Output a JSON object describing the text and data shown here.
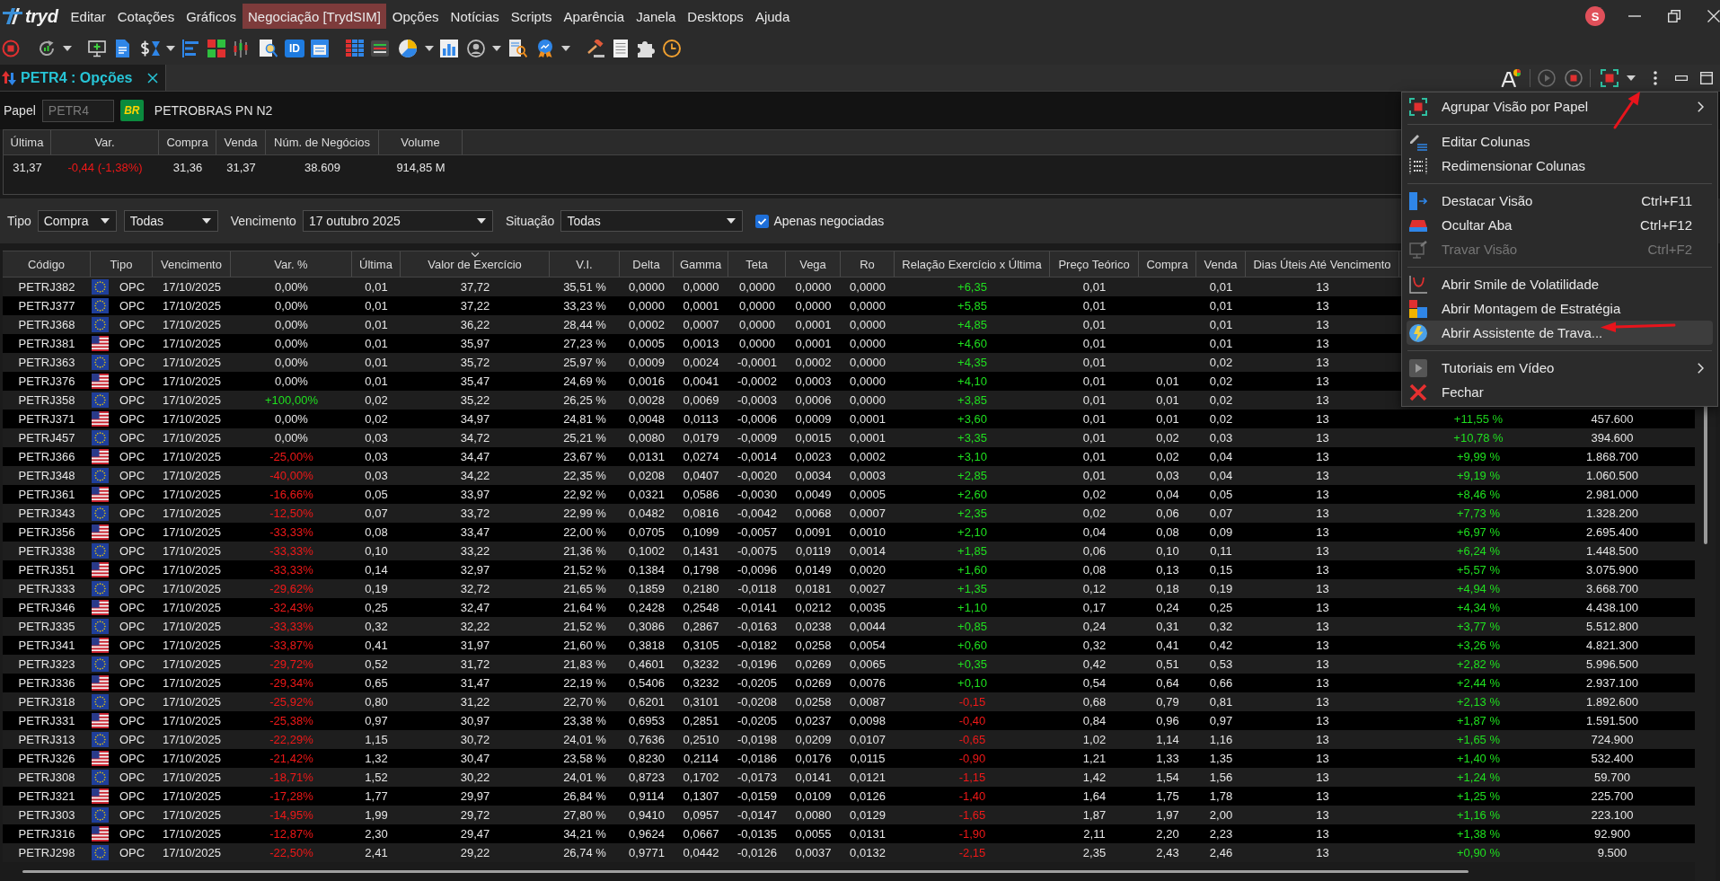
{
  "window": {
    "logo_text": "tryd",
    "avatar_letter": "S"
  },
  "menu_bar": [
    {
      "label": "Editar",
      "selected": false
    },
    {
      "label": "Cotações",
      "selected": false
    },
    {
      "label": "Gráficos",
      "selected": false
    },
    {
      "label": "Negociação [TrydSIM]",
      "selected": true
    },
    {
      "label": "Opções",
      "selected": false
    },
    {
      "label": "Notícias",
      "selected": false
    },
    {
      "label": "Scripts",
      "selected": false
    },
    {
      "label": "Aparência",
      "selected": false
    },
    {
      "label": "Janela",
      "selected": false
    },
    {
      "label": "Desktops",
      "selected": false
    },
    {
      "label": "Ajuda",
      "selected": false
    }
  ],
  "toolbar": {
    "text_button": "ID"
  },
  "tabs": [
    {
      "label": "PETR4 : Opções",
      "selected": true
    }
  ],
  "instrument": {
    "label": "Papel",
    "placeholder": "PETR4",
    "logo_text": "BR",
    "name": "PETROBRAS PN N2"
  },
  "quote": {
    "columns": [
      "Última",
      "Var.",
      "Compra",
      "Venda",
      "Núm. de Negócios",
      "Volume"
    ],
    "values": [
      {
        "text": "31,37",
        "color": "#e6e6e6"
      },
      {
        "text": "-0,44 (-1,38%)",
        "color": "#f01818"
      },
      {
        "text": "31,36",
        "color": "#e6e6e6"
      },
      {
        "text": "31,37",
        "color": "#e6e6e6"
      },
      {
        "text": "38.609",
        "color": "#e6e6e6"
      },
      {
        "text": "914,85 M",
        "color": "#e6e6e6"
      }
    ]
  },
  "filters": [
    {
      "kind": "label",
      "text": "Tipo"
    },
    {
      "kind": "dropdown",
      "value": "Compra"
    },
    {
      "kind": "dropdown",
      "value": "Todas"
    },
    {
      "kind": "label",
      "text": "Vencimento"
    },
    {
      "kind": "dropdown",
      "value": "17 outubro 2025"
    },
    {
      "kind": "label",
      "text": "Situação"
    },
    {
      "kind": "dropdown",
      "value": "Todas"
    },
    {
      "kind": "checkbox",
      "label": "Apenas negociadas",
      "checked": true
    }
  ],
  "table": {
    "columns": [
      {
        "label": "Código",
        "sorted": false
      },
      {
        "label": "Tipo",
        "sorted": false
      },
      {
        "label": "Vencimento",
        "sorted": false
      },
      {
        "label": "Var. %",
        "sorted": false
      },
      {
        "label": "Última",
        "sorted": false
      },
      {
        "label": "Valor de Exercício",
        "sorted": true
      },
      {
        "label": "V.I.",
        "sorted": false
      },
      {
        "label": "Delta",
        "sorted": false
      },
      {
        "label": "Gamma",
        "sorted": false
      },
      {
        "label": "Teta",
        "sorted": false
      },
      {
        "label": "Vega",
        "sorted": false
      },
      {
        "label": "Ro",
        "sorted": false
      },
      {
        "label": "Relação Exercício x Última",
        "sorted": false
      },
      {
        "label": "Preço Teórico",
        "sorted": false
      },
      {
        "label": "Compra",
        "sorted": false
      },
      {
        "label": "Venda",
        "sorted": false
      },
      {
        "label": "Dias Úteis Até Vencimento",
        "sorted": false
      }
    ],
    "rows": [
      {
        "codigo": "PETRJ382",
        "kind": "eu",
        "tipo": "OPC",
        "vencimento": "17/10/2025",
        "var": {
          "text": "0,00%",
          "color": "#e6e6e6"
        },
        "ultima": "0,01",
        "valor_exercicio": "37,72",
        "vi": "35,51 %",
        "delta": "0,0000",
        "gamma": "0,0000",
        "teta": "0,0000",
        "vega": "0,0000",
        "ro": "0,0000",
        "relacao": {
          "text": "+6,35",
          "color": "#1fe01f"
        },
        "preco_teorico": "0,01",
        "venda": "0,01",
        "dias_uteis": "13"
      },
      {
        "codigo": "PETRJ377",
        "kind": "eu",
        "tipo": "OPC",
        "vencimento": "17/10/2025",
        "var": {
          "text": "0,00%",
          "color": "#e6e6e6"
        },
        "ultima": "0,01",
        "valor_exercicio": "37,22",
        "vi": "33,23 %",
        "delta": "0,0000",
        "gamma": "0,0001",
        "teta": "0,0000",
        "vega": "0,0000",
        "ro": "0,0000",
        "relacao": {
          "text": "+5,85",
          "color": "#1fe01f"
        },
        "preco_teorico": "0,01",
        "venda": "0,01",
        "dias_uteis": "13"
      },
      {
        "codigo": "PETRJ368",
        "kind": "eu",
        "tipo": "OPC",
        "vencimento": "17/10/2025",
        "var": {
          "text": "0,00%",
          "color": "#e6e6e6"
        },
        "ultima": "0,01",
        "valor_exercicio": "36,22",
        "vi": "28,44 %",
        "delta": "0,0002",
        "gamma": "0,0007",
        "teta": "0,0000",
        "vega": "0,0001",
        "ro": "0,0000",
        "relacao": {
          "text": "+4,85",
          "color": "#1fe01f"
        },
        "preco_teorico": "0,01",
        "venda": "0,01",
        "dias_uteis": "13"
      },
      {
        "codigo": "PETRJ381",
        "kind": "us",
        "tipo": "OPC",
        "vencimento": "17/10/2025",
        "var": {
          "text": "0,00%",
          "color": "#e6e6e6"
        },
        "ultima": "0,01",
        "valor_exercicio": "35,97",
        "vi": "27,23 %",
        "delta": "0,0005",
        "gamma": "0,0013",
        "teta": "0,0000",
        "vega": "0,0001",
        "ro": "0,0000",
        "relacao": {
          "text": "+4,60",
          "color": "#1fe01f"
        },
        "preco_teorico": "0,01",
        "venda": "0,01",
        "dias_uteis": "13"
      },
      {
        "codigo": "PETRJ363",
        "kind": "eu",
        "tipo": "OPC",
        "vencimento": "17/10/2025",
        "var": {
          "text": "0,00%",
          "color": "#e6e6e6"
        },
        "ultima": "0,01",
        "valor_exercicio": "35,72",
        "vi": "25,97 %",
        "delta": "0,0009",
        "gamma": "0,0024",
        "teta": "-0,0001",
        "vega": "0,0002",
        "ro": "0,0000",
        "relacao": {
          "text": "+4,35",
          "color": "#1fe01f"
        },
        "preco_teorico": "0,01",
        "venda": "0,02",
        "dias_uteis": "13"
      },
      {
        "codigo": "PETRJ376",
        "kind": "us",
        "tipo": "OPC",
        "vencimento": "17/10/2025",
        "var": {
          "text": "0,00%",
          "color": "#e6e6e6"
        },
        "ultima": "0,01",
        "valor_exercicio": "35,47",
        "vi": "24,69 %",
        "delta": "0,0016",
        "gamma": "0,0041",
        "teta": "-0,0002",
        "vega": "0,0003",
        "ro": "0,0000",
        "relacao": {
          "text": "+4,10",
          "color": "#1fe01f"
        },
        "preco_teorico": "0,01",
        "compra": "0,01",
        "venda": "0,02",
        "dias_uteis": "13"
      },
      {
        "codigo": "PETRJ358",
        "kind": "eu",
        "tipo": "OPC",
        "vencimento": "17/10/2025",
        "var": {
          "text": "+100,00%",
          "color": "#1fe01f"
        },
        "ultima": "0,02",
        "valor_exercicio": "35,22",
        "vi": "26,25 %",
        "delta": "0,0028",
        "gamma": "0,0069",
        "teta": "-0,0003",
        "vega": "0,0006",
        "ro": "0,0000",
        "relacao": {
          "text": "+3,85",
          "color": "#1fe01f"
        },
        "preco_teorico": "0,01",
        "compra": "0,01",
        "venda": "0,02",
        "dias_uteis": "13"
      },
      {
        "codigo": "PETRJ371",
        "kind": "us",
        "tipo": "OPC",
        "vencimento": "17/10/2025",
        "var": {
          "text": "0,00%",
          "color": "#e6e6e6"
        },
        "ultima": "0,02",
        "valor_exercicio": "34,97",
        "vi": "24,81 %",
        "delta": "0,0048",
        "gamma": "0,0113",
        "teta": "-0,0006",
        "vega": "0,0009",
        "ro": "0,0001",
        "relacao": {
          "text": "+3,60",
          "color": "#1fe01f"
        },
        "preco_teorico": "0,01",
        "compra": "0,01",
        "venda": "0,02",
        "dias_uteis": "13",
        "column_18": "+11,55 %",
        "column_19": "457.600"
      },
      {
        "codigo": "PETRJ457",
        "kind": "eu",
        "tipo": "OPC",
        "vencimento": "17/10/2025",
        "var": {
          "text": "0,00%",
          "color": "#e6e6e6"
        },
        "ultima": "0,03",
        "valor_exercicio": "34,72",
        "vi": "25,21 %",
        "delta": "0,0080",
        "gamma": "0,0179",
        "teta": "-0,0009",
        "vega": "0,0015",
        "ro": "0,0001",
        "relacao": {
          "text": "+3,35",
          "color": "#1fe01f"
        },
        "preco_teorico": "0,01",
        "compra": "0,02",
        "venda": "0,03",
        "dias_uteis": "13",
        "column_18": "+10,78 %",
        "column_19": "394.600"
      },
      {
        "codigo": "PETRJ366",
        "kind": "us",
        "tipo": "OPC",
        "vencimento": "17/10/2025",
        "var": {
          "text": "-25,00%",
          "color": "#f01818"
        },
        "ultima": "0,03",
        "valor_exercicio": "34,47",
        "vi": "23,67 %",
        "delta": "0,0131",
        "gamma": "0,0274",
        "teta": "-0,0014",
        "vega": "0,0023",
        "ro": "0,0002",
        "relacao": {
          "text": "+3,10",
          "color": "#1fe01f"
        },
        "preco_teorico": "0,01",
        "compra": "0,02",
        "venda": "0,04",
        "dias_uteis": "13",
        "column_18": "+9,99 %",
        "column_19": "1.868.700"
      },
      {
        "codigo": "PETRJ348",
        "kind": "eu",
        "tipo": "OPC",
        "vencimento": "17/10/2025",
        "var": {
          "text": "-40,00%",
          "color": "#f01818"
        },
        "ultima": "0,03",
        "valor_exercicio": "34,22",
        "vi": "22,35 %",
        "delta": "0,0208",
        "gamma": "0,0407",
        "teta": "-0,0020",
        "vega": "0,0034",
        "ro": "0,0003",
        "relacao": {
          "text": "+2,85",
          "color": "#1fe01f"
        },
        "preco_teorico": "0,01",
        "compra": "0,03",
        "venda": "0,04",
        "dias_uteis": "13",
        "column_18": "+9,19 %",
        "column_19": "1.060.500"
      },
      {
        "codigo": "PETRJ361",
        "kind": "us",
        "tipo": "OPC",
        "vencimento": "17/10/2025",
        "var": {
          "text": "-16,66%",
          "color": "#f01818"
        },
        "ultima": "0,05",
        "valor_exercicio": "33,97",
        "vi": "22,92 %",
        "delta": "0,0321",
        "gamma": "0,0586",
        "teta": "-0,0030",
        "vega": "0,0049",
        "ro": "0,0005",
        "relacao": {
          "text": "+2,60",
          "color": "#1fe01f"
        },
        "preco_teorico": "0,02",
        "compra": "0,04",
        "venda": "0,05",
        "dias_uteis": "13",
        "column_18": "+8,46 %",
        "column_19": "2.981.000"
      },
      {
        "codigo": "PETRJ343",
        "kind": "eu",
        "tipo": "OPC",
        "vencimento": "17/10/2025",
        "var": {
          "text": "-12,50%",
          "color": "#f01818"
        },
        "ultima": "0,07",
        "valor_exercicio": "33,72",
        "vi": "22,99 %",
        "delta": "0,0482",
        "gamma": "0,0816",
        "teta": "-0,0042",
        "vega": "0,0068",
        "ro": "0,0007",
        "relacao": {
          "text": "+2,35",
          "color": "#1fe01f"
        },
        "preco_teorico": "0,02",
        "compra": "0,06",
        "venda": "0,07",
        "dias_uteis": "13",
        "column_18": "+7,73 %",
        "column_19": "1.328.200"
      },
      {
        "codigo": "PETRJ356",
        "kind": "us",
        "tipo": "OPC",
        "vencimento": "17/10/2025",
        "var": {
          "text": "-33,33%",
          "color": "#f01818"
        },
        "ultima": "0,08",
        "valor_exercicio": "33,47",
        "vi": "22,00 %",
        "delta": "0,0705",
        "gamma": "0,1099",
        "teta": "-0,0057",
        "vega": "0,0091",
        "ro": "0,0010",
        "relacao": {
          "text": "+2,10",
          "color": "#1fe01f"
        },
        "preco_teorico": "0,04",
        "compra": "0,08",
        "venda": "0,09",
        "dias_uteis": "13",
        "column_18": "+6,97 %",
        "column_19": "2.695.400"
      },
      {
        "codigo": "PETRJ338",
        "kind": "eu",
        "tipo": "OPC",
        "vencimento": "17/10/2025",
        "var": {
          "text": "-33,33%",
          "color": "#f01818"
        },
        "ultima": "0,10",
        "valor_exercicio": "33,22",
        "vi": "21,36 %",
        "delta": "0,1002",
        "gamma": "0,1431",
        "teta": "-0,0075",
        "vega": "0,0119",
        "ro": "0,0014",
        "relacao": {
          "text": "+1,85",
          "color": "#1fe01f"
        },
        "preco_teorico": "0,06",
        "compra": "0,10",
        "venda": "0,11",
        "dias_uteis": "13",
        "column_18": "+6,24 %",
        "column_19": "1.448.500"
      },
      {
        "codigo": "PETRJ351",
        "kind": "us",
        "tipo": "OPC",
        "vencimento": "17/10/2025",
        "var": {
          "text": "-33,33%",
          "color": "#f01818"
        },
        "ultima": "0,14",
        "valor_exercicio": "32,97",
        "vi": "21,52 %",
        "delta": "0,1384",
        "gamma": "0,1798",
        "teta": "-0,0096",
        "vega": "0,0149",
        "ro": "0,0020",
        "relacao": {
          "text": "+1,60",
          "color": "#1fe01f"
        },
        "preco_teorico": "0,08",
        "compra": "0,13",
        "venda": "0,15",
        "dias_uteis": "13",
        "column_18": "+5,57 %",
        "column_19": "3.075.900"
      },
      {
        "codigo": "PETRJ333",
        "kind": "eu",
        "tipo": "OPC",
        "vencimento": "17/10/2025",
        "var": {
          "text": "-29,62%",
          "color": "#f01818"
        },
        "ultima": "0,19",
        "valor_exercicio": "32,72",
        "vi": "21,65 %",
        "delta": "0,1859",
        "gamma": "0,2180",
        "teta": "-0,0118",
        "vega": "0,0181",
        "ro": "0,0027",
        "relacao": {
          "text": "+1,35",
          "color": "#1fe01f"
        },
        "preco_teorico": "0,12",
        "compra": "0,18",
        "venda": "0,19",
        "dias_uteis": "13",
        "column_18": "+4,94 %",
        "column_19": "3.668.700"
      },
      {
        "codigo": "PETRJ346",
        "kind": "us",
        "tipo": "OPC",
        "vencimento": "17/10/2025",
        "var": {
          "text": "-32,43%",
          "color": "#f01818"
        },
        "ultima": "0,25",
        "valor_exercicio": "32,47",
        "vi": "21,64 %",
        "delta": "0,2428",
        "gamma": "0,2548",
        "teta": "-0,0141",
        "vega": "0,0212",
        "ro": "0,0035",
        "relacao": {
          "text": "+1,10",
          "color": "#1fe01f"
        },
        "preco_teorico": "0,17",
        "compra": "0,24",
        "venda": "0,25",
        "dias_uteis": "13",
        "column_18": "+4,34 %",
        "column_19": "4.438.100"
      },
      {
        "codigo": "PETRJ335",
        "kind": "eu",
        "tipo": "OPC",
        "vencimento": "17/10/2025",
        "var": {
          "text": "-33,33%",
          "color": "#f01818"
        },
        "ultima": "0,32",
        "valor_exercicio": "32,22",
        "vi": "21,52 %",
        "delta": "0,3086",
        "gamma": "0,2867",
        "teta": "-0,0163",
        "vega": "0,0238",
        "ro": "0,0044",
        "relacao": {
          "text": "+0,85",
          "color": "#1fe01f"
        },
        "preco_teorico": "0,24",
        "compra": "0,31",
        "venda": "0,32",
        "dias_uteis": "13",
        "column_18": "+3,77 %",
        "column_19": "5.512.800"
      },
      {
        "codigo": "PETRJ341",
        "kind": "us",
        "tipo": "OPC",
        "vencimento": "17/10/2025",
        "var": {
          "text": "-33,87%",
          "color": "#f01818"
        },
        "ultima": "0,41",
        "valor_exercicio": "31,97",
        "vi": "21,60 %",
        "delta": "0,3818",
        "gamma": "0,3105",
        "teta": "-0,0182",
        "vega": "0,0258",
        "ro": "0,0054",
        "relacao": {
          "text": "+0,60",
          "color": "#1fe01f"
        },
        "preco_teorico": "0,32",
        "compra": "0,41",
        "venda": "0,42",
        "dias_uteis": "13",
        "column_18": "+3,26 %",
        "column_19": "4.821.300"
      },
      {
        "codigo": "PETRJ323",
        "kind": "eu",
        "tipo": "OPC",
        "vencimento": "17/10/2025",
        "var": {
          "text": "-29,72%",
          "color": "#f01818"
        },
        "ultima": "0,52",
        "valor_exercicio": "31,72",
        "vi": "21,83 %",
        "delta": "0,4601",
        "gamma": "0,3232",
        "teta": "-0,0196",
        "vega": "0,0269",
        "ro": "0,0065",
        "relacao": {
          "text": "+0,35",
          "color": "#1fe01f"
        },
        "preco_teorico": "0,42",
        "compra": "0,51",
        "venda": "0,53",
        "dias_uteis": "13",
        "column_18": "+2,82 %",
        "column_19": "5.996.500"
      },
      {
        "codigo": "PETRJ336",
        "kind": "us",
        "tipo": "OPC",
        "vencimento": "17/10/2025",
        "var": {
          "text": "-29,34%",
          "color": "#f01818"
        },
        "ultima": "0,65",
        "valor_exercicio": "31,47",
        "vi": "22,19 %",
        "delta": "0,5406",
        "gamma": "0,3232",
        "teta": "-0,0205",
        "vega": "0,0269",
        "ro": "0,0076",
        "relacao": {
          "text": "+0,10",
          "color": "#1fe01f"
        },
        "preco_teorico": "0,54",
        "compra": "0,64",
        "venda": "0,66",
        "dias_uteis": "13",
        "column_18": "+2,44 %",
        "column_19": "2.937.100"
      },
      {
        "codigo": "PETRJ318",
        "kind": "eu",
        "tipo": "OPC",
        "vencimento": "17/10/2025",
        "var": {
          "text": "-25,92%",
          "color": "#f01818"
        },
        "ultima": "0,80",
        "valor_exercicio": "31,22",
        "vi": "22,70 %",
        "delta": "0,6201",
        "gamma": "0,3101",
        "teta": "-0,0208",
        "vega": "0,0258",
        "ro": "0,0087",
        "relacao": {
          "text": "-0,15",
          "color": "#f01818"
        },
        "preco_teorico": "0,68",
        "compra": "0,79",
        "venda": "0,81",
        "dias_uteis": "13",
        "column_18": "+2,13 %",
        "column_19": "1.892.600"
      },
      {
        "codigo": "PETRJ331",
        "kind": "us",
        "tipo": "OPC",
        "vencimento": "17/10/2025",
        "var": {
          "text": "-25,38%",
          "color": "#f01818"
        },
        "ultima": "0,97",
        "valor_exercicio": "30,97",
        "vi": "23,38 %",
        "delta": "0,6953",
        "gamma": "0,2851",
        "teta": "-0,0205",
        "vega": "0,0237",
        "ro": "0,0098",
        "relacao": {
          "text": "-0,40",
          "color": "#f01818"
        },
        "preco_teorico": "0,84",
        "compra": "0,96",
        "venda": "0,97",
        "dias_uteis": "13",
        "column_18": "+1,87 %",
        "column_19": "1.591.500"
      },
      {
        "codigo": "PETRJ313",
        "kind": "eu",
        "tipo": "OPC",
        "vencimento": "17/10/2025",
        "var": {
          "text": "-22,29%",
          "color": "#f01818"
        },
        "ultima": "1,15",
        "valor_exercicio": "30,72",
        "vi": "24,01 %",
        "delta": "0,7636",
        "gamma": "0,2510",
        "teta": "-0,0198",
        "vega": "0,0209",
        "ro": "0,0107",
        "relacao": {
          "text": "-0,65",
          "color": "#f01818"
        },
        "preco_teorico": "1,02",
        "compra": "1,14",
        "venda": "1,16",
        "dias_uteis": "13",
        "column_18": "+1,65 %",
        "column_19": "724.900"
      },
      {
        "codigo": "PETRJ326",
        "kind": "us",
        "tipo": "OPC",
        "vencimento": "17/10/2025",
        "var": {
          "text": "-21,42%",
          "color": "#f01818"
        },
        "ultima": "1,32",
        "valor_exercicio": "30,47",
        "vi": "23,58 %",
        "delta": "0,8230",
        "gamma": "0,2114",
        "teta": "-0,0186",
        "vega": "0,0176",
        "ro": "0,0115",
        "relacao": {
          "text": "-0,90",
          "color": "#f01818"
        },
        "preco_teorico": "1,21",
        "compra": "1,33",
        "venda": "1,35",
        "dias_uteis": "13",
        "column_18": "+1,40 %",
        "column_19": "532.400"
      },
      {
        "codigo": "PETRJ308",
        "kind": "eu",
        "tipo": "OPC",
        "vencimento": "17/10/2025",
        "var": {
          "text": "-18,71%",
          "color": "#f01818"
        },
        "ultima": "1,52",
        "valor_exercicio": "30,22",
        "vi": "24,01 %",
        "delta": "0,8723",
        "gamma": "0,1702",
        "teta": "-0,0173",
        "vega": "0,0141",
        "ro": "0,0121",
        "relacao": {
          "text": "-1,15",
          "color": "#f01818"
        },
        "preco_teorico": "1,42",
        "compra": "1,54",
        "venda": "1,56",
        "dias_uteis": "13",
        "column_18": "+1,24 %",
        "column_19": "59.700"
      },
      {
        "codigo": "PETRJ321",
        "kind": "us",
        "tipo": "OPC",
        "vencimento": "17/10/2025",
        "var": {
          "text": "-17,28%",
          "color": "#f01818"
        },
        "ultima": "1,77",
        "valor_exercicio": "29,97",
        "vi": "26,84 %",
        "delta": "0,9114",
        "gamma": "0,1307",
        "teta": "-0,0159",
        "vega": "0,0109",
        "ro": "0,0126",
        "relacao": {
          "text": "-1,40",
          "color": "#f01818"
        },
        "preco_teorico": "1,64",
        "compra": "1,75",
        "venda": "1,78",
        "dias_uteis": "13",
        "column_18": "+1,25 %",
        "column_19": "225.700"
      },
      {
        "codigo": "PETRJ303",
        "kind": "eu",
        "tipo": "OPC",
        "vencimento": "17/10/2025",
        "var": {
          "text": "-14,95%",
          "color": "#f01818"
        },
        "ultima": "1,99",
        "valor_exercicio": "29,72",
        "vi": "27,80 %",
        "delta": "0,9410",
        "gamma": "0,0957",
        "teta": "-0,0147",
        "vega": "0,0080",
        "ro": "0,0129",
        "relacao": {
          "text": "-1,65",
          "color": "#f01818"
        },
        "preco_teorico": "1,87",
        "compra": "1,97",
        "venda": "2,00",
        "dias_uteis": "13",
        "column_18": "+1,16 %",
        "column_19": "223.100"
      },
      {
        "codigo": "PETRJ316",
        "kind": "us",
        "tipo": "OPC",
        "vencimento": "17/10/2025",
        "var": {
          "text": "-12,87%",
          "color": "#f01818"
        },
        "ultima": "2,30",
        "valor_exercicio": "29,47",
        "vi": "34,21 %",
        "delta": "0,9624",
        "gamma": "0,0667",
        "teta": "-0,0135",
        "vega": "0,0055",
        "ro": "0,0131",
        "relacao": {
          "text": "-1,90",
          "color": "#f01818"
        },
        "preco_teorico": "2,11",
        "compra": "2,20",
        "venda": "2,23",
        "dias_uteis": "13",
        "column_18": "+1,38 %",
        "column_19": "92.900"
      },
      {
        "codigo": "PETRJ298",
        "kind": "eu",
        "tipo": "OPC",
        "vencimento": "17/10/2025",
        "var": {
          "text": "-22,50%",
          "color": "#f01818"
        },
        "ultima": "2,41",
        "valor_exercicio": "29,22",
        "vi": "26,74 %",
        "delta": "0,9771",
        "gamma": "0,0442",
        "teta": "-0,0126",
        "vega": "0,0037",
        "ro": "0,0132",
        "relacao": {
          "text": "-2,15",
          "color": "#f01818"
        },
        "preco_teorico": "2,35",
        "compra": "2,43",
        "venda": "2,46",
        "dias_uteis": "13",
        "column_18": "+0,90 %",
        "column_19": "9.500"
      }
    ]
  },
  "context_menu": {
    "groups": [
      {
        "items": [
          {
            "label": "Agrupar Visão por Papel",
            "submenu": true,
            "disabled": false,
            "highlighted": false
          }
        ]
      },
      {
        "items": [
          {
            "label": "Editar Colunas",
            "submenu": false,
            "disabled": false,
            "highlighted": false
          },
          {
            "label": "Redimensionar Colunas",
            "submenu": false,
            "disabled": false,
            "highlighted": false
          }
        ]
      },
      {
        "items": [
          {
            "label": "Destacar Visão",
            "shortcut": "Ctrl+F11",
            "submenu": false,
            "disabled": false,
            "highlighted": false
          },
          {
            "label": "Ocultar Aba",
            "shortcut": "Ctrl+F12",
            "submenu": false,
            "disabled": false,
            "highlighted": false
          },
          {
            "label": "Travar Visão",
            "shortcut": "Ctrl+F2",
            "submenu": false,
            "disabled": true,
            "highlighted": false
          }
        ]
      },
      {
        "items": [
          {
            "label": "Abrir Smile de Volatilidade",
            "submenu": false,
            "disabled": false,
            "highlighted": false
          },
          {
            "label": "Abrir Montagem de Estratégia",
            "submenu": false,
            "disabled": false,
            "highlighted": false
          },
          {
            "label": "Abrir Assistente de Trava...",
            "submenu": false,
            "disabled": false,
            "highlighted": true
          }
        ]
      },
      {
        "items": [
          {
            "label": "Tutoriais em Vídeo",
            "submenu": true,
            "disabled": false,
            "highlighted": false
          },
          {
            "label": "Fechar",
            "submenu": false,
            "disabled": false,
            "highlighted": false
          }
        ]
      }
    ]
  }
}
